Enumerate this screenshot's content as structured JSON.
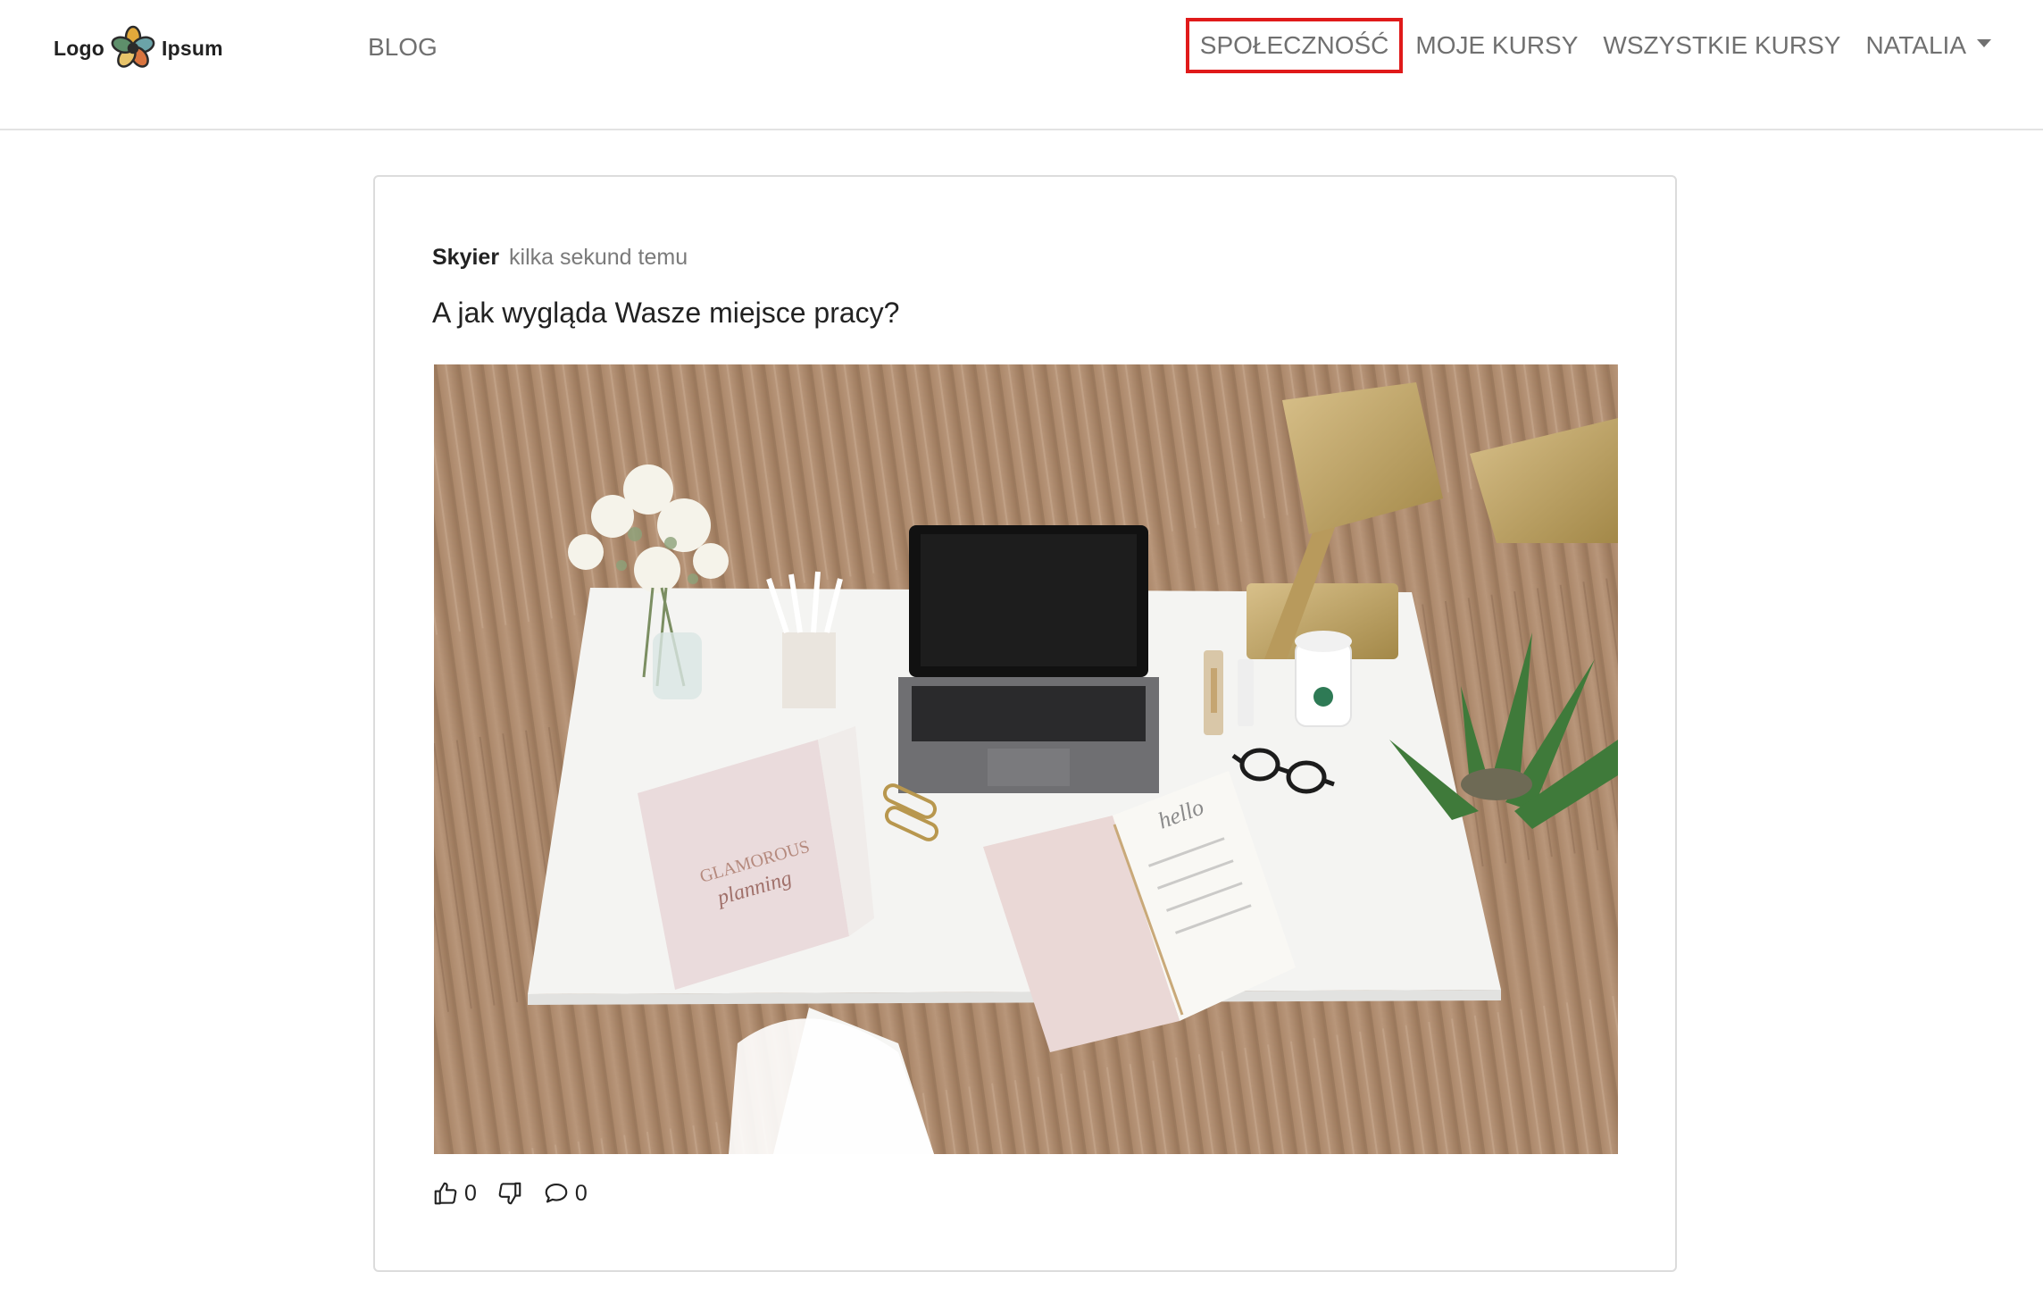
{
  "header": {
    "logo": {
      "left_text": "Logo",
      "right_text": "Ipsum",
      "icon": "flower-logo-icon"
    },
    "nav_left": [
      {
        "label": "BLOG"
      }
    ],
    "nav_right": [
      {
        "label": "SPOŁECZNOŚĆ",
        "highlighted": true
      },
      {
        "label": "MOJE KURSY"
      },
      {
        "label": "WSZYSTKIE KURSY"
      },
      {
        "label": "NATALIA",
        "has_dropdown": true
      }
    ]
  },
  "post": {
    "author": "Skyier",
    "time": "kilka sekund temu",
    "title": "A jak wygląda Wasze miejsce pracy?",
    "image": {
      "icon": "desk-photo-image"
    },
    "actions": {
      "like": {
        "icon": "thumbs-up-icon",
        "count": "0"
      },
      "dislike": {
        "icon": "thumbs-down-icon"
      },
      "comments": {
        "icon": "comment-icon",
        "count": "0"
      }
    }
  },
  "colors": {
    "nav_text": "#707070",
    "highlight_border": "#e01a1a",
    "divider": "#e3e3e3",
    "card_border": "#dcdcdc"
  }
}
